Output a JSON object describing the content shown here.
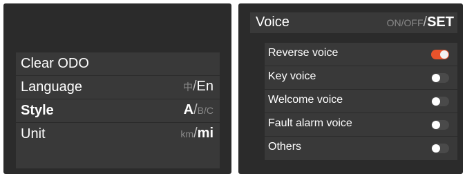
{
  "left_menu": {
    "items": [
      {
        "label": "Clear ODO"
      },
      {
        "label": "Language",
        "opts": {
          "dim": "中",
          "sep": "/",
          "strong": "En"
        }
      },
      {
        "label": "Style",
        "opts": {
          "strong": "A",
          "sep": "/",
          "dim": "B/C"
        }
      },
      {
        "label": "Unit",
        "opts": {
          "dim": "km",
          "sep": "/",
          "strong": "mi"
        }
      }
    ]
  },
  "voice": {
    "title": "Voice",
    "header_dim": "ON/OFF",
    "header_sep": "/",
    "header_strong": "SET",
    "items": [
      {
        "label": "Reverse voice",
        "on": true
      },
      {
        "label": "Key voice",
        "on": false
      },
      {
        "label": "Welcome voice",
        "on": false
      },
      {
        "label": "Fault alarm voice",
        "on": false
      },
      {
        "label": "Others",
        "on": false
      }
    ]
  },
  "colors": {
    "panel_bg": "#2b2b2b",
    "row_bg": "#393939",
    "toggle_on": "#e8532b",
    "toggle_off": "#4a4a4a"
  }
}
